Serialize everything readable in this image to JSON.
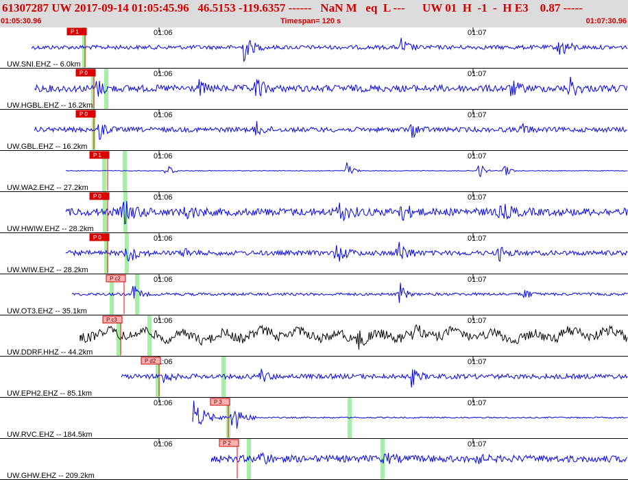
{
  "header": {
    "title": "61307287 UW 2017-09-14 01:05:45.96   46.5153 -119.6357 ------   NaN M   eq  L ---      UW 01  H  -1  -  H E3    0.87 -----",
    "time_start": "01:05:30.96",
    "timespan": "Timespan= 120 s",
    "time_end": "01:07:30.96"
  },
  "time_ticks": [
    "01:06",
    "01:07"
  ],
  "colors": {
    "header_bg": "#dcdcdc",
    "header_text": "#d00000",
    "trace_blue": "#0000ee",
    "trace_black": "#000000",
    "pick_dark": "#dd0000",
    "pick_light": "#ffb0b0",
    "phase_window": "#a6f0a6"
  },
  "channels": [
    {
      "label": "UW.SNI.EHZ -- 6.0km",
      "pick": "P 1",
      "pick_style": "dark",
      "color": "blue",
      "start_s": 3.5
    },
    {
      "label": "UW.HGBL.EHZ -- 16.2km",
      "pick": "P 0",
      "pick_style": "dark",
      "color": "blue",
      "start_s": 4.0
    },
    {
      "label": "UW.GBL.EHZ -- 16.2km",
      "pick": "P 0",
      "pick_style": "dark",
      "color": "blue",
      "start_s": 4.0
    },
    {
      "label": "UW.WA2.EHZ -- 27.2km",
      "pick": "P 1",
      "pick_style": "dark",
      "color": "blue",
      "start_s": 10.0
    },
    {
      "label": "UW.HWIW.EHZ -- 28.2km",
      "pick": "P 0",
      "pick_style": "dark",
      "color": "blue",
      "start_s": 10.0
    },
    {
      "label": "UW.WIW.EHZ -- 28.2km",
      "pick": "P 0",
      "pick_style": "dark",
      "color": "blue",
      "start_s": 10.0
    },
    {
      "label": "UW.OT3.EHZ -- 35.1km",
      "pick": "P c2",
      "pick_style": "light",
      "color": "blue",
      "start_s": 11.2
    },
    {
      "label": "UW.DDRF.HHZ -- 44.2km",
      "pick": "P c3",
      "pick_style": "light",
      "color": "black",
      "start_s": 12.7
    },
    {
      "label": "UW.EPH2.EHZ -- 85.1km",
      "pick": "P d2",
      "pick_style": "light",
      "color": "blue",
      "start_s": 20.6
    },
    {
      "label": "UW.RVC.EHZ -- 184.5km",
      "pick": "P 3",
      "pick_style": "light",
      "color": "blue",
      "start_s": 34.2
    },
    {
      "label": "UW.GHW.EHZ -- 209.2km",
      "pick": "P 2",
      "pick_style": "light",
      "color": "blue",
      "start_s": 37.8
    }
  ]
}
